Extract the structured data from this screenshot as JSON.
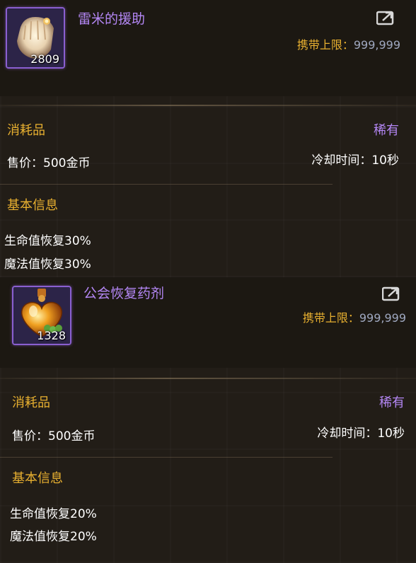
{
  "items": [
    {
      "name": "雷米的援助",
      "quantity": "2809",
      "icon": "glove-icon",
      "carry_label": "携带上限：",
      "carry_value": "999,999",
      "type": "消耗品",
      "rarity": "稀有",
      "price_label": "售价：",
      "price_value": "500金币",
      "cooldown_label": "冷却时间：",
      "cooldown_value": "10秒",
      "section_title": "基本信息",
      "effects": [
        "生命值恢复30%",
        "魔法值恢复30%"
      ]
    },
    {
      "name": "公会恢复药剂",
      "quantity": "1328",
      "icon": "heart-potion-icon",
      "carry_label": "携带上限：",
      "carry_value": "999,999",
      "type": "消耗品",
      "rarity": "稀有",
      "price_label": "售价：",
      "price_value": "500金币",
      "cooldown_label": "冷却时间：",
      "cooldown_value": "10秒",
      "section_title": "基本信息",
      "effects": [
        "生命值恢复20%",
        "魔法值恢复20%"
      ]
    }
  ],
  "colors": {
    "gold": "#e8b030",
    "purple": "#b487f5",
    "number": "#9fa8c0",
    "text": "#ffffff"
  }
}
